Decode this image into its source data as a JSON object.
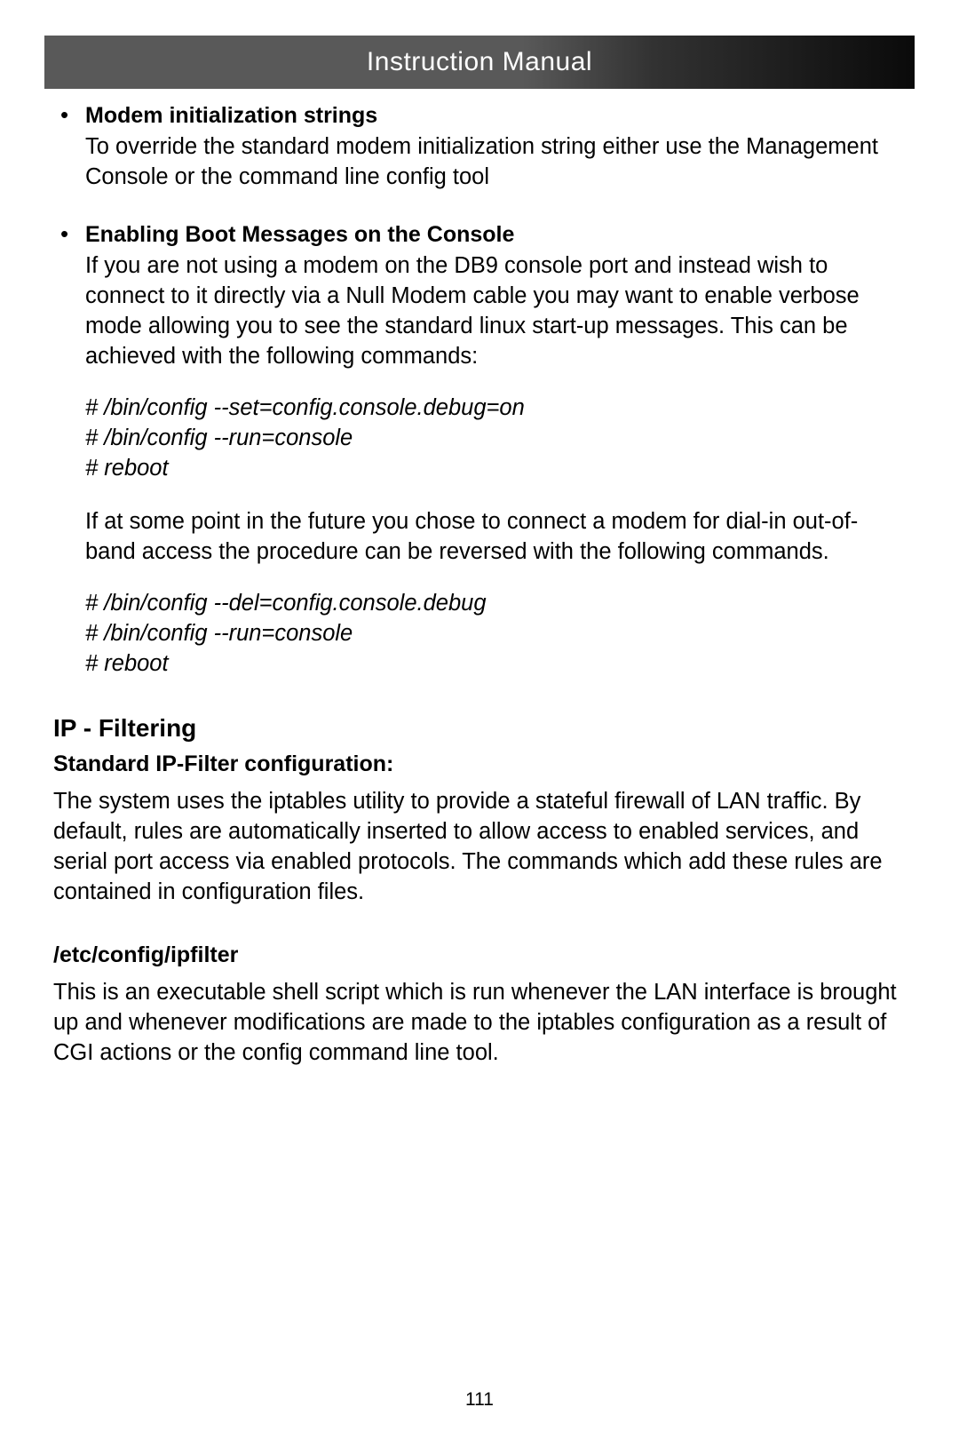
{
  "banner": {
    "title": "Instruction Manual"
  },
  "bullets": [
    {
      "title": "Modem initialization strings",
      "body1": "To override the standard modem initialization string either use the Management Console or the command line config tool"
    },
    {
      "title": "Enabling Boot Messages on the Console",
      "body1": "If you are not using a modem on the DB9 console port and instead wish to connect to it directly via a Null Modem cable you may want to enable verbose mode allowing you to see the standard linux start-up messages. This can be achieved with the following commands:",
      "code1_l1": "# /bin/config --set=config.console.debug=on",
      "code1_l2": "# /bin/config --run=console",
      "code1_l3": "# reboot",
      "body2": "If at some point in the future you chose to connect a modem for dial-in out-of-band access the procedure can be reversed with the following commands.",
      "code2_l1": "# /bin/config --del=config.console.debug",
      "code2_l2": "# /bin/config --run=console",
      "code2_l3": "# reboot"
    }
  ],
  "section": {
    "heading": "IP - Filtering",
    "sub1_title": "Standard IP-Filter configuration:",
    "sub1_body": "The system uses the iptables utility to provide a stateful firewall of LAN traffic. By default, rules are automatically inserted to allow access to enabled services, and serial port access via enabled protocols. The commands which add these rules are contained in configuration files.",
    "sub2_title": "/etc/config/ipfilter",
    "sub2_body": "This is an executable shell script which is run whenever the LAN interface is brought up and whenever modifications are made to the iptables configuration as a result of CGI actions or the config command line tool."
  },
  "page_number": "111"
}
